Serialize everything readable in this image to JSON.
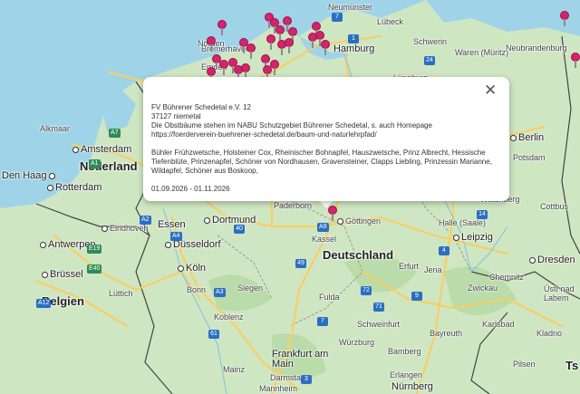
{
  "map": {
    "colors": {
      "land": "#cfe6c2",
      "water": "#9fd3e8",
      "motorway": "#f6cf65",
      "border": "#333333",
      "pin": "#d6236e"
    },
    "places": {
      "amsterdam": "Amsterdam",
      "nederland": "Nederland",
      "den_haag": "Den Haag",
      "rotterdam": "Rotterdam",
      "alkmaar": "Alkmaar",
      "eindhoven": "Eindhoven",
      "antwerpen": "Antwerpen",
      "brussel": "Brüssel",
      "belgien": "Belgien",
      "luttich": "Lüttich",
      "essen": "Essen",
      "dortmund": "Dortmund",
      "dusseldorf": "Düsseldorf",
      "koln": "Köln",
      "bonn": "Bonn",
      "koblenz": "Koblenz",
      "mainz": "Mainz",
      "frankfurt": "Frankfurt am Main",
      "darmstadt": "Darmstadt",
      "mannheim": "Mannheim",
      "siegen": "Siegen",
      "paderborn": "Paderborn",
      "kassel": "Kassel",
      "gottingen": "Göttingen",
      "deutschland": "Deutschland",
      "fulda": "Fulda",
      "erfurt": "Erfurt",
      "jena": "Jena",
      "halle": "Halle (Saale)",
      "leipzig": "Leipzig",
      "dresden": "Dresden",
      "chemnitz": "Chemnitz",
      "zwickau": "Zwickau",
      "schweinfurt": "Schweinfurt",
      "wurzburg": "Würzburg",
      "bamberg": "Bamberg",
      "erlangen": "Erlangen",
      "nurnberg": "Nürnberg",
      "bayreuth": "Bayreuth",
      "karlsbad": "Karlsbad",
      "plzen": "Pilsen",
      "kladno": "Kladno",
      "usti": "Ústí nad Labem",
      "lubeck": "Lübeck",
      "neumunster": "Neumünster",
      "hamburg": "Hamburg",
      "schwerin": "Schwerin",
      "neubrandenburg": "Neubrandenburg",
      "waren": "Waren (Müritz)",
      "luneburg": "Lüneburg",
      "berlin": "Berlin",
      "potsdam": "Potsdam",
      "wittenberg": "Wittenberg",
      "bremerhaven": "Bremerhaven",
      "norden": "Norden",
      "emden": "Emden",
      "cottbus": "Cottbus",
      "ts": "Ts"
    },
    "roads": [
      "7",
      "1",
      "24",
      "A7",
      "A1",
      "A2",
      "A4",
      "A9",
      "A3",
      "E40",
      "A12",
      "E19",
      "40",
      "49",
      "4",
      "9",
      "61",
      "3",
      "7",
      "71",
      "72",
      "14"
    ],
    "pin_icon": "map-pin-icon"
  },
  "popup": {
    "title": "FV Bührener Schedetal e.V. 12",
    "address": "37127 niemetal",
    "description": "Die Obstbäume stehen im NABU Schutzgebiet Bührener Schedetal, s. auch Homepage https://foerderverein-buehrener-schedetal.de/baum-und-naturlehrpfad/",
    "varieties": "Bühler Frühzwetsche, Holsteiner Cox, Rheinischer Bohnapfel, Hauszwetsche, Prinz Albrecht, Hessische Tiefenblüte, Prinzenapfel, Schöner von Nordhausen, Gravensteiner, Clapps Liebling, Prinzessin Marianne, Wildapfel, Schöner aus Boskoop,",
    "dates": "01.09.2026 - 01.11.2026",
    "close_icon": "close-icon",
    "close_glyph": "✕"
  }
}
